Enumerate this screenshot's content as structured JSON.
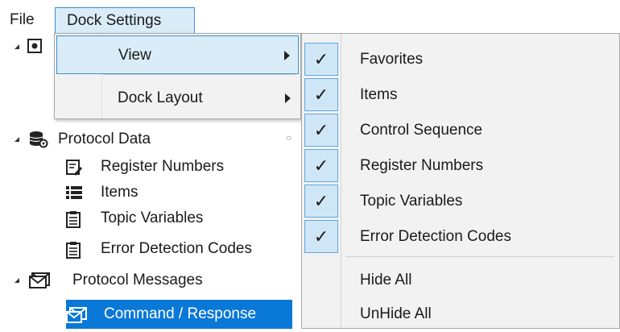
{
  "menubar": {
    "file": "File",
    "dock_settings": "Dock Settings"
  },
  "dropdown": {
    "items": [
      {
        "label": "View",
        "has_submenu": true,
        "highlighted": true
      },
      {
        "label": "Dock Layout",
        "has_submenu": true,
        "highlighted": false
      }
    ]
  },
  "submenu": {
    "items": [
      {
        "label": "Favorites",
        "checked": true
      },
      {
        "label": "Items",
        "checked": true
      },
      {
        "label": "Control Sequence",
        "checked": true
      },
      {
        "label": "Register Numbers",
        "checked": true
      },
      {
        "label": "Topic Variables",
        "checked": true
      },
      {
        "label": "Error Detection Codes",
        "checked": true
      },
      {
        "label": "Hide All",
        "checked": false
      },
      {
        "label": "UnHide All",
        "checked": false
      }
    ],
    "check_glyph": "✓"
  },
  "tree": {
    "protocol_data": {
      "label": "Protocol Data",
      "children": [
        {
          "label": "Register Numbers",
          "icon": "register-numbers-icon"
        },
        {
          "label": "Items",
          "icon": "list-icon"
        },
        {
          "label": "Topic Variables",
          "icon": "document-icon"
        },
        {
          "label": "Error Detection Codes",
          "icon": "document-icon"
        }
      ]
    },
    "protocol_messages": {
      "label": "Protocol Messages",
      "children": [
        {
          "label": "Command / Response",
          "icon": "command-response-icon",
          "selected": true
        }
      ]
    }
  },
  "colors": {
    "accent": "#0a78d7",
    "menu_highlight": "#d9ecf8",
    "menu_border": "#3a8fd0"
  }
}
